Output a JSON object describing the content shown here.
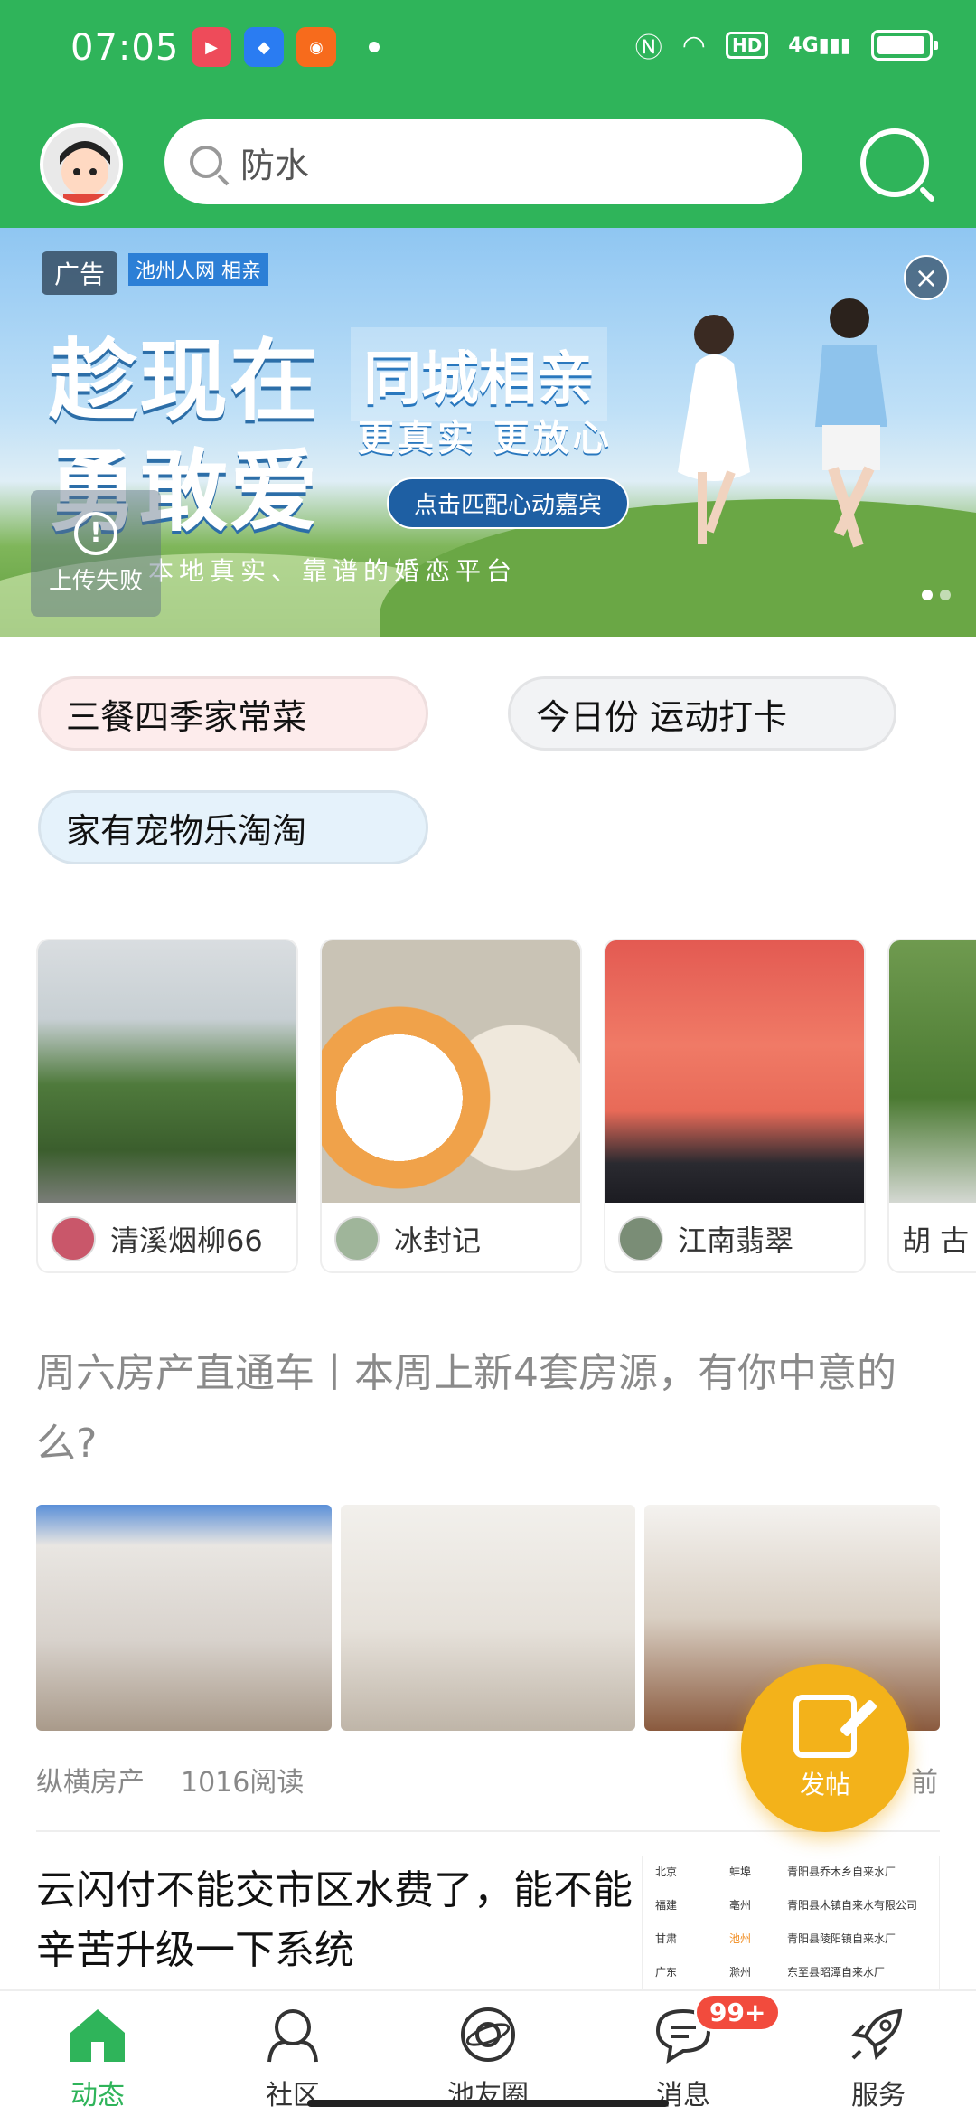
{
  "status_bar": {
    "time": "07:05",
    "network": "4G",
    "hd": "HD"
  },
  "header": {
    "search_placeholder": "防水"
  },
  "banner": {
    "ad_tag": "广告",
    "brand": "池州人网 相亲",
    "headline_1": "趁现在",
    "headline_2": "勇敢爱",
    "city_title": "同城相亲",
    "city_sub": "更真实 更放心",
    "cta": "点击匹配心动嘉宾",
    "tagline": "本地真实、靠谱的婚恋平台",
    "upload_fail": "上传失败"
  },
  "topics": [
    {
      "label": "三餐四季家常菜"
    },
    {
      "label": "今日份 运动打卡"
    },
    {
      "label": "家有宠物乐淘淘"
    }
  ],
  "cards": [
    {
      "user": "清溪烟柳66"
    },
    {
      "user": "冰封记"
    },
    {
      "user": "江南翡翠"
    },
    {
      "user": "胡 古"
    }
  ],
  "article1": {
    "title": "周六房产直通车丨本周上新4套房源，有你中意的么?",
    "source": "纵横房产",
    "reads": "1016阅读",
    "time_suffix": "前"
  },
  "fab": {
    "label": "发帖"
  },
  "article2": {
    "title": "云闪付不能交市区水费了，能不能辛苦升级一下系统",
    "thumb_regions": [
      "北京",
      "福建",
      "甘肃",
      "广东"
    ],
    "thumb_cities": [
      "蚌埠",
      "亳州",
      "池州",
      "滁州"
    ],
    "thumb_plants": [
      "青阳县乔木乡自来水厂",
      "青阳县木镇自来水有限公司",
      "青阳县陵阳镇自来水厂",
      "东至县昭潭自来水厂"
    ]
  },
  "nav": [
    {
      "label": "动态",
      "icon": "home-icon",
      "active": true
    },
    {
      "label": "社区",
      "icon": "community-icon"
    },
    {
      "label": "池友圈",
      "icon": "planet-icon"
    },
    {
      "label": "消息",
      "icon": "message-icon",
      "badge": "99+"
    },
    {
      "label": "服务",
      "icon": "rocket-icon"
    }
  ],
  "colors": {
    "brand_green": "#2fb45a",
    "fab_orange": "#f3b21a",
    "badge_red": "#f24b3d"
  }
}
